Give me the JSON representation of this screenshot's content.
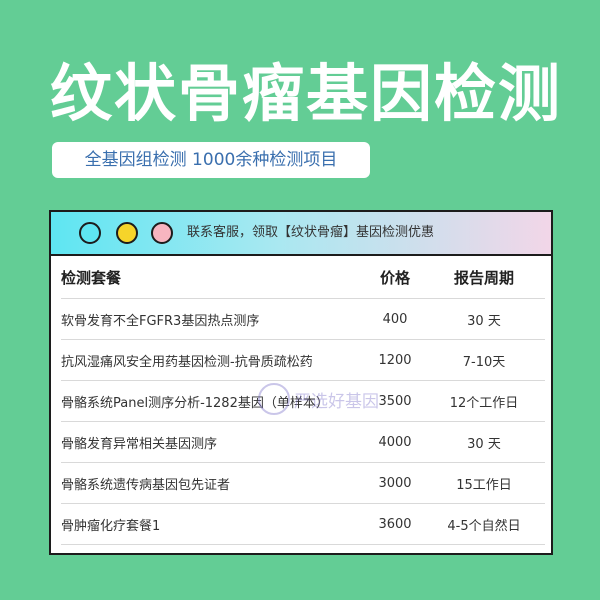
{
  "title": "纹状骨瘤基因检测",
  "subtitle": "全基因组检测 1000余种检测项目",
  "panel": {
    "notice": "联系客服，领取【纹状骨瘤】基因检测优惠"
  },
  "table": {
    "headers": {
      "name": "检测套餐",
      "price": "价格",
      "cycle": "报告周期"
    },
    "rows": [
      {
        "name": "软骨发育不全FGFR3基因热点测序",
        "price": "400",
        "cycle": "30 天"
      },
      {
        "name": "抗风湿痛风安全用药基因检测-抗骨质疏松药",
        "price": "1200",
        "cycle": "7-10天"
      },
      {
        "name": "骨骼系统Panel测序分析-1282基因（单样本）",
        "price": "3500",
        "cycle": "12个工作日"
      },
      {
        "name": "骨骼发育异常相关基因测序",
        "price": "4000",
        "cycle": "30 天"
      },
      {
        "name": "骨骼系统遗传病基因包先证者",
        "price": "3000",
        "cycle": "15工作日"
      },
      {
        "name": "骨肿瘤化疗套餐1",
        "price": "3600",
        "cycle": "4-5个自然日"
      }
    ]
  },
  "watermark": {
    "text": "严选好基因"
  },
  "colors": {
    "background": "#63cd95",
    "subtitle_text": "#3a6fae",
    "dot1": "#5ee6f2",
    "dot2": "#f6d42a",
    "dot3": "#f7b5c0"
  }
}
